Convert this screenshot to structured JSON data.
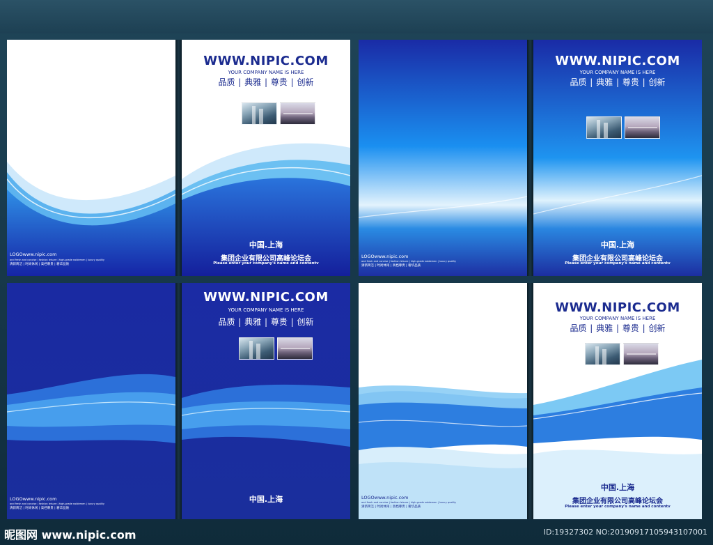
{
  "colors": {
    "navy": "#1b2b8f",
    "blue": "#1a5fd0",
    "white": "#ffffff"
  },
  "brand": {
    "url": "WWW.NIPIC.COM",
    "company": "YOUR COMPANY NAME IS HERE",
    "slogan": "品质 | 典雅 | 尊贵 | 创新"
  },
  "cover": {
    "city": "中国.上海",
    "conference": "集团企业有限公司高峰论坛会",
    "subtitle": "Please enter your company's name and contentv"
  },
  "back": {
    "logo": "LOGOwww.nipic.com",
    "tiny": "and fresh and concise  |  fashion leisure  |  high-grade noblemen  |  luxury quality",
    "tags": "清新简洁 | 时尚休闲 | 高档尊贵 | 奢华品质"
  },
  "footer": {
    "logo": "昵图网 www.nipic.com",
    "id": "ID:19327302 NO:20190917105943107001"
  },
  "icons": {
    "photo_city": "building-photo-icon",
    "photo_bridge": "bridge-photo-icon"
  }
}
